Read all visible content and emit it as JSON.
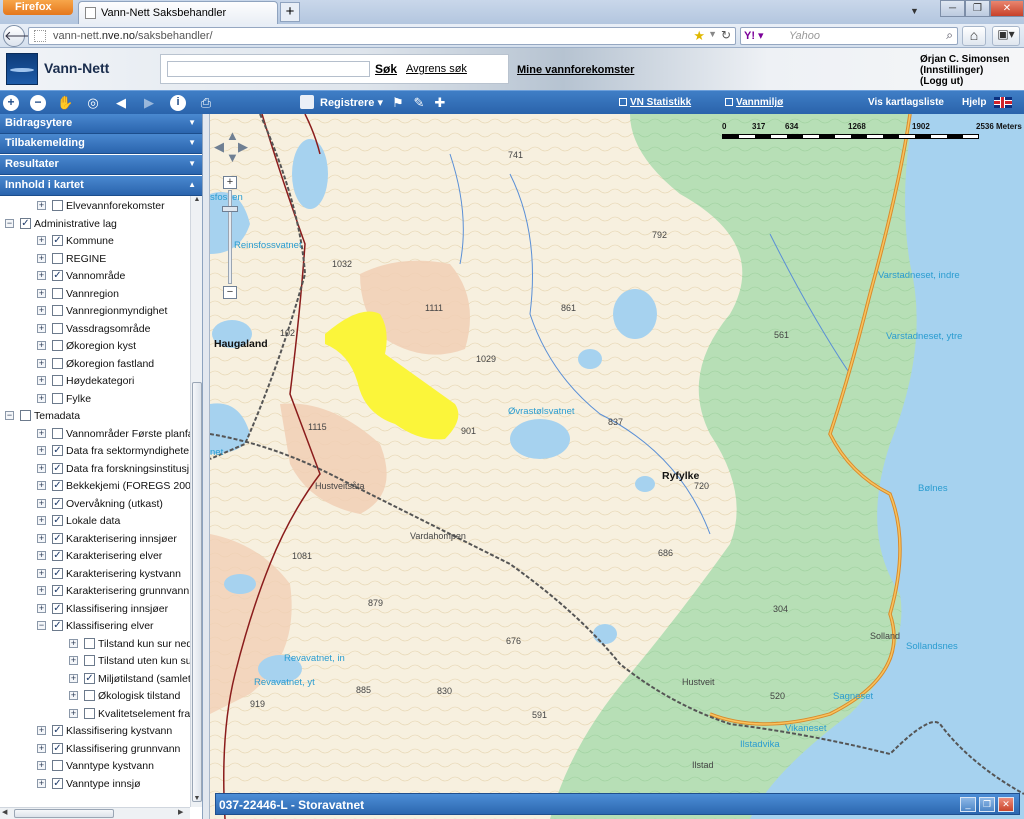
{
  "browser": {
    "menu_button": "Firefox",
    "tab_title": "Vann-Nett Saksbehandler",
    "new_tab": "+",
    "url_pre": "vann-nett.",
    "url_host": "nve.no",
    "url_post": "/saksbehandler/",
    "search_engine_placeholder": "Yahoo",
    "window_controls": {
      "minimize": "─",
      "maximize": "❐",
      "close": "✕"
    }
  },
  "header": {
    "app_title": "Vann-Nett",
    "search_placeholder": "",
    "search_button": "Søk",
    "refine_link": "Avgrens søk",
    "my_waterbodies_link": "Mine vannforekomster",
    "user_name": "Ørjan C. Simonsen",
    "settings_link": "(Innstillinger)",
    "logout_link": "(Logg ut)"
  },
  "toolbar": {
    "registrere": "Registrere",
    "vn_statistikk": "VN Statistikk",
    "vannmiljo": "Vannmiljø",
    "vis_kartlagsliste": "Vis kartlagsliste",
    "hjelp": "Hjelp"
  },
  "sidebar": {
    "panels": [
      {
        "label": "Bidragsytere"
      },
      {
        "label": "Tilbakemelding"
      },
      {
        "label": "Resultater"
      },
      {
        "label": "Innhold i kartet"
      }
    ],
    "tree": [
      {
        "label": "Elvevannforekomster",
        "level": 1,
        "checked": false,
        "expander": "+"
      },
      {
        "label": "Administrative lag",
        "level": 0,
        "checked": true,
        "expander": "−"
      },
      {
        "label": "Kommune",
        "level": 1,
        "checked": true,
        "expander": "+"
      },
      {
        "label": "REGINE",
        "level": 1,
        "checked": false,
        "expander": "+"
      },
      {
        "label": "Vannområde",
        "level": 1,
        "checked": true,
        "expander": "+"
      },
      {
        "label": "Vannregion",
        "level": 1,
        "checked": false,
        "expander": "+"
      },
      {
        "label": "Vannregionmyndighet",
        "level": 1,
        "checked": false,
        "expander": "+"
      },
      {
        "label": "Vassdragsområde",
        "level": 1,
        "checked": false,
        "expander": "+"
      },
      {
        "label": "Økoregion kyst",
        "level": 1,
        "checked": false,
        "expander": "+"
      },
      {
        "label": "Økoregion fastland",
        "level": 1,
        "checked": false,
        "expander": "+"
      },
      {
        "label": "Høydekategori",
        "level": 1,
        "checked": false,
        "expander": "+"
      },
      {
        "label": "Fylke",
        "level": 1,
        "checked": false,
        "expander": "+"
      },
      {
        "label": "Temadata",
        "level": 0,
        "checked": false,
        "expander": "−"
      },
      {
        "label": "Vannområder Første planfa",
        "level": 1,
        "checked": false,
        "expander": "+"
      },
      {
        "label": "Data fra sektormyndighete",
        "level": 1,
        "checked": true,
        "expander": "+"
      },
      {
        "label": "Data fra forskningsinstitusj",
        "level": 1,
        "checked": true,
        "expander": "+"
      },
      {
        "label": "Bekkekjemi (FOREGS 2008",
        "level": 1,
        "checked": true,
        "expander": "+"
      },
      {
        "label": "Overvåkning (utkast)",
        "level": 1,
        "checked": true,
        "expander": "+"
      },
      {
        "label": "Lokale data",
        "level": 1,
        "checked": true,
        "expander": "+"
      },
      {
        "label": "Karakterisering innsjøer",
        "level": 1,
        "checked": true,
        "expander": "+"
      },
      {
        "label": "Karakterisering elver",
        "level": 1,
        "checked": true,
        "expander": "+"
      },
      {
        "label": "Karakterisering kystvann",
        "level": 1,
        "checked": true,
        "expander": "+"
      },
      {
        "label": "Karakterisering grunnvann",
        "level": 1,
        "checked": true,
        "expander": "+"
      },
      {
        "label": "Klassifisering innsjøer",
        "level": 1,
        "checked": true,
        "expander": "+"
      },
      {
        "label": "Klassifisering elver",
        "level": 1,
        "checked": true,
        "expander": "−"
      },
      {
        "label": "Tilstand kun sur ned",
        "level": 2,
        "checked": false,
        "expander": "+"
      },
      {
        "label": "Tilstand uten kun su",
        "level": 2,
        "checked": false,
        "expander": "+"
      },
      {
        "label": "Miljøtilstand (samlet",
        "level": 2,
        "checked": true,
        "expander": "+"
      },
      {
        "label": "Økologisk tilstand",
        "level": 2,
        "checked": false,
        "expander": "+"
      },
      {
        "label": "Kvalitetselement fra",
        "level": 2,
        "checked": false,
        "expander": "+"
      },
      {
        "label": "Klassifisering kystvann",
        "level": 1,
        "checked": true,
        "expander": "+"
      },
      {
        "label": "Klassifisering grunnvann",
        "level": 1,
        "checked": true,
        "expander": "+"
      },
      {
        "label": "Vanntype kystvann",
        "level": 1,
        "checked": false,
        "expander": "+"
      },
      {
        "label": "Vanntype innsjø",
        "level": 1,
        "checked": true,
        "expander": "+"
      }
    ]
  },
  "map": {
    "scale_labels": [
      "0",
      "317",
      "634",
      "1268",
      "1902",
      "2536 Meters"
    ],
    "selected_waterbody": "037-22446-L - Storavatnet",
    "place_labels": [
      {
        "text": "Haugaland",
        "kind": "big"
      },
      {
        "text": "Ryfylke",
        "kind": "big"
      },
      {
        "text": "Reinsfossvatnet",
        "kind": "water"
      },
      {
        "text": "sfossen",
        "kind": "water"
      },
      {
        "text": "Øvrastølsvatnet",
        "kind": "water"
      },
      {
        "text": "Varstadneset, indre",
        "kind": "water"
      },
      {
        "text": "Varstadneset, ytre",
        "kind": "water"
      },
      {
        "text": "Bølnes",
        "kind": "water"
      },
      {
        "text": "Sagneset",
        "kind": "water"
      },
      {
        "text": "Vikaneset",
        "kind": "water"
      },
      {
        "text": "Ilstadvika",
        "kind": "water"
      },
      {
        "text": "Sollandsnes",
        "kind": "water"
      },
      {
        "text": "Revavatnet, in",
        "kind": "water"
      },
      {
        "text": "Revavatnet, yt",
        "kind": "water"
      },
      {
        "text": "net",
        "kind": "water"
      },
      {
        "text": "Hustveitsåta",
        "kind": "plain"
      },
      {
        "text": "Vardahompen",
        "kind": "plain"
      },
      {
        "text": "Hustveit",
        "kind": "plain"
      },
      {
        "text": "Ilstad",
        "kind": "plain"
      },
      {
        "text": "Solland",
        "kind": "plain"
      },
      {
        "text": "520",
        "kind": "plain"
      },
      {
        "text": "741",
        "kind": "num"
      },
      {
        "text": "792",
        "kind": "num"
      },
      {
        "text": "1032",
        "kind": "num"
      },
      {
        "text": "1111",
        "kind": "num"
      },
      {
        "text": "861",
        "kind": "num"
      },
      {
        "text": "561",
        "kind": "num"
      },
      {
        "text": "1029",
        "kind": "num"
      },
      {
        "text": "837",
        "kind": "num"
      },
      {
        "text": "901",
        "kind": "num"
      },
      {
        "text": "1115",
        "kind": "num"
      },
      {
        "text": "720",
        "kind": "num"
      },
      {
        "text": "1081",
        "kind": "num"
      },
      {
        "text": "686",
        "kind": "num"
      },
      {
        "text": "879",
        "kind": "num"
      },
      {
        "text": "304",
        "kind": "num"
      },
      {
        "text": "676",
        "kind": "num"
      },
      {
        "text": "885",
        "kind": "num"
      },
      {
        "text": "830",
        "kind": "num"
      },
      {
        "text": "919",
        "kind": "num"
      },
      {
        "text": "591",
        "kind": "num"
      },
      {
        "text": "102",
        "kind": "num"
      }
    ]
  },
  "colors": {
    "toolbar_blue": "#2f6cb4",
    "selection_yellow": "#fbf53a",
    "forest_green": "#b7dfb6",
    "water_blue": "#a6d2ef",
    "heath_beige": "#f7f0df",
    "heath_orange": "#f1cfb5"
  }
}
